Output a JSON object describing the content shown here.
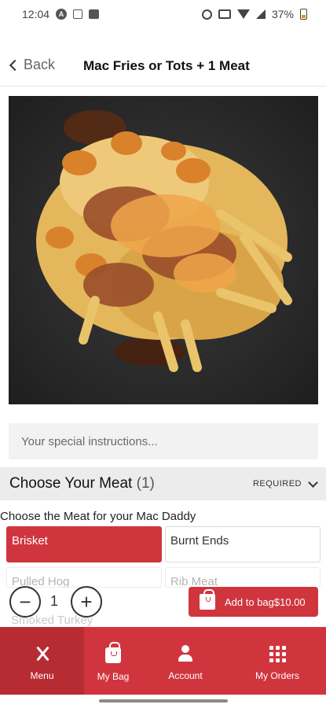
{
  "status_bar": {
    "time": "12:04",
    "battery": "37%",
    "icons": [
      "a-circle-icon",
      "calendar-icon",
      "image-icon",
      "alarm-icon",
      "vibrate-icon",
      "wifi-icon",
      "signal-icon",
      "battery-icon"
    ]
  },
  "header": {
    "back_label": "Back",
    "title": "Mac Fries or Tots + 1 Meat"
  },
  "special_instructions": {
    "placeholder": "Your special instructions..."
  },
  "meat_section": {
    "title": "Choose Your Meat",
    "count": "(1)",
    "required_label": "REQUIRED",
    "subtitle": "Choose the Meat for your Mac Daddy",
    "options": [
      {
        "label": "Brisket",
        "selected": true
      },
      {
        "label": "Burnt Ends",
        "selected": false
      },
      {
        "label": "Pulled Hog",
        "selected": false
      },
      {
        "label": "Rib Meat",
        "selected": false
      },
      {
        "label": "Smoked Turkey",
        "selected": false
      }
    ]
  },
  "quantity": {
    "minus": "−",
    "value": "1",
    "plus": "+"
  },
  "add_to_bag": {
    "label": "Add to bag",
    "price": "$10.00"
  },
  "bottom_nav": {
    "items": [
      {
        "label": "Menu",
        "icon": "fork-knife-icon",
        "active": true
      },
      {
        "label": "My Bag",
        "icon": "bag-icon",
        "active": false
      },
      {
        "label": "Account",
        "icon": "account-icon",
        "active": false
      },
      {
        "label": "My Orders",
        "icon": "grid-icon",
        "active": false
      }
    ]
  },
  "colors": {
    "accent": "#d0353e",
    "accent_active": "#b72b33",
    "section_bg": "#ececec",
    "input_bg": "#f2f2f2"
  }
}
